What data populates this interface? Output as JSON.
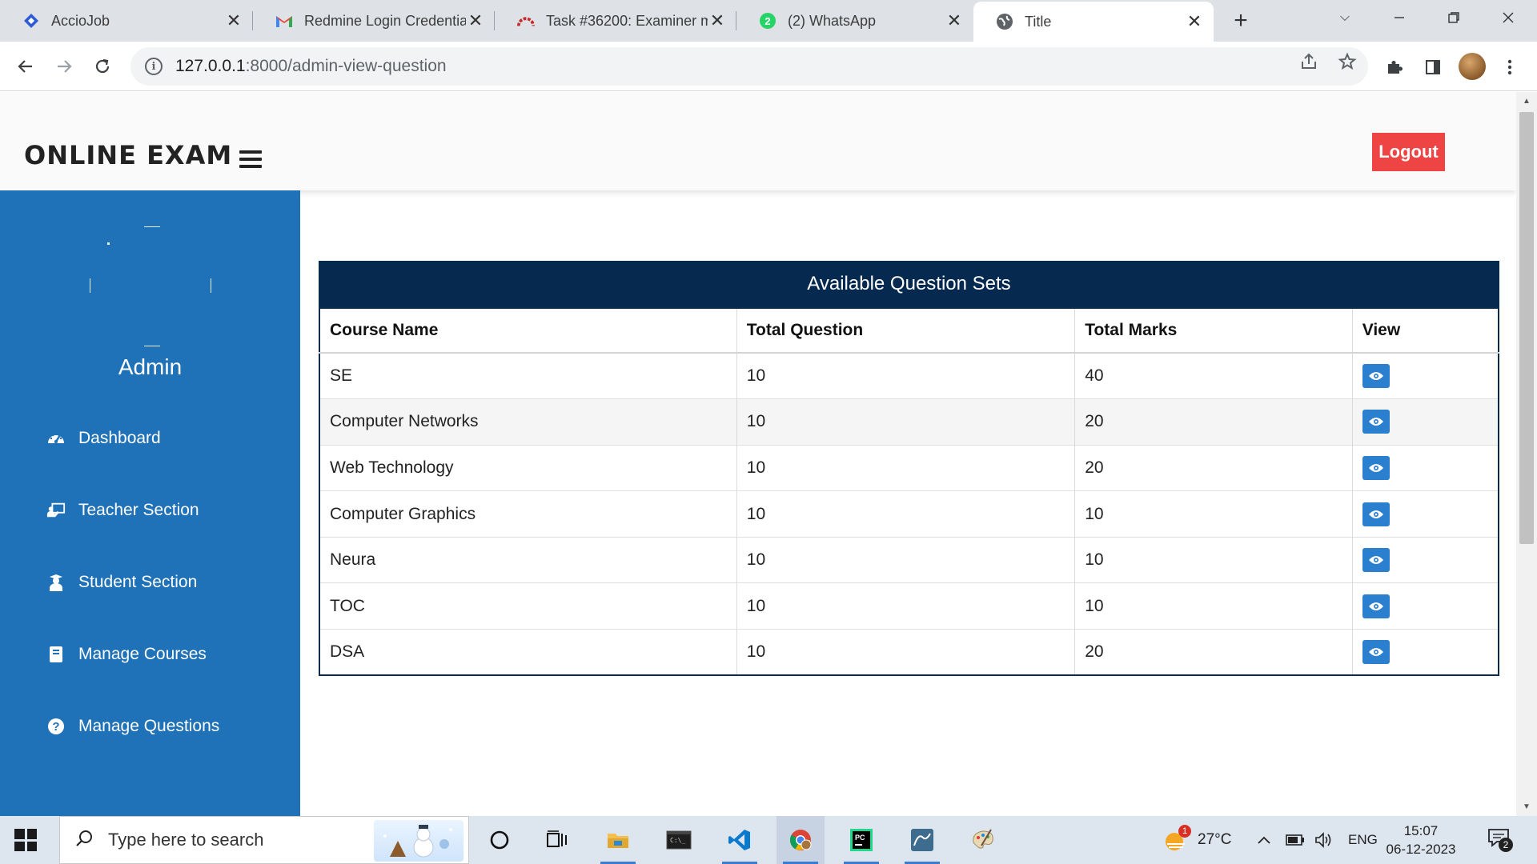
{
  "browser": {
    "tabs": [
      {
        "title": "AccioJob",
        "icon": "acciojob-icon"
      },
      {
        "title": "Redmine Login Credentia",
        "icon": "gmail-icon"
      },
      {
        "title": "Task #36200: Examiner m",
        "icon": "redmine-icon"
      },
      {
        "title": "(2) WhatsApp",
        "icon": "whatsapp-icon"
      },
      {
        "title": "Title",
        "icon": "globe-icon"
      }
    ],
    "url_host": "127.0.0.1",
    "url_path": ":8000/admin-view-question"
  },
  "header": {
    "brand": "ONLINE EXAM",
    "logout_label": "Logout"
  },
  "sidebar": {
    "user_name": "Admin",
    "items": [
      {
        "label": "Dashboard",
        "icon": "tachometer-icon"
      },
      {
        "label": "Teacher Section",
        "icon": "teacher-icon"
      },
      {
        "label": "Student Section",
        "icon": "student-icon"
      },
      {
        "label": "Manage Courses",
        "icon": "book-icon"
      },
      {
        "label": "Manage Questions",
        "icon": "question-circle-icon"
      }
    ]
  },
  "table": {
    "caption": "Available Question Sets",
    "headers": [
      "Course Name",
      "Total Question",
      "Total Marks",
      "View"
    ],
    "rows": [
      {
        "course": "SE",
        "questions": "10",
        "marks": "40"
      },
      {
        "course": "Computer Networks",
        "questions": "10",
        "marks": "20"
      },
      {
        "course": "Web Technology",
        "questions": "10",
        "marks": "20"
      },
      {
        "course": "Computer Graphics",
        "questions": "10",
        "marks": "10"
      },
      {
        "course": "Neura",
        "questions": "10",
        "marks": "10"
      },
      {
        "course": "TOC",
        "questions": "10",
        "marks": "10"
      },
      {
        "course": "DSA",
        "questions": "10",
        "marks": "20"
      }
    ]
  },
  "taskbar": {
    "search_placeholder": "Type here to search",
    "weather_badge": "1",
    "temperature": "27°C",
    "language": "ENG",
    "time": "15:07",
    "date": "06-12-2023",
    "notification_count": "2"
  },
  "colors": {
    "sidebar": "#1f71b8",
    "table_caption": "#062a4f",
    "logout": "#ef4444",
    "view_button": "#2a7fcf"
  }
}
